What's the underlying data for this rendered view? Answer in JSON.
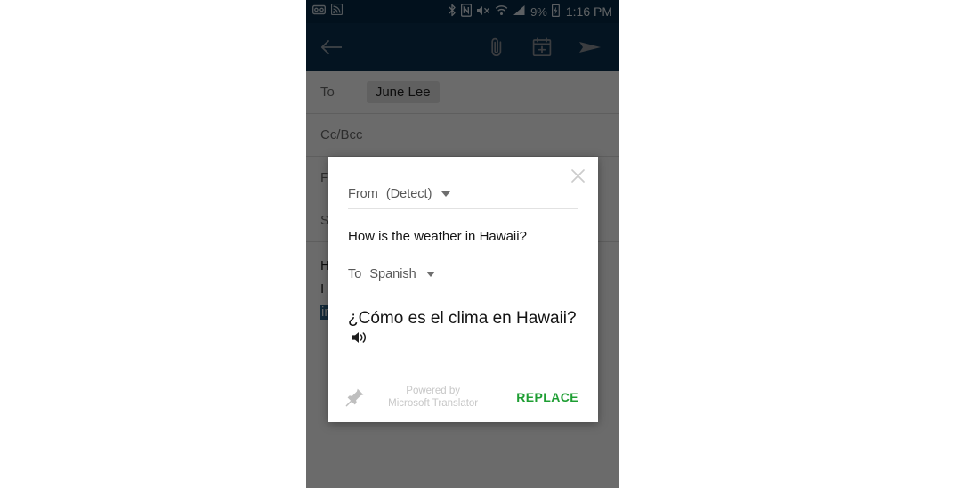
{
  "status_bar": {
    "left_icons": [
      "voicemail-icon",
      "rss-icon"
    ],
    "right_icons": [
      "bluetooth-icon",
      "nfc-icon",
      "volume-mute-icon",
      "wifi-icon",
      "cellular-signal-icon"
    ],
    "battery_percent": "9%",
    "battery_icon": "battery-charging-icon",
    "time": "1:16 PM"
  },
  "toolbar": {
    "back_icon": "back-arrow-icon",
    "attach_icon": "paperclip-icon",
    "calendar_icon": "calendar-add-icon",
    "send_icon": "send-icon"
  },
  "compose": {
    "to_label": "To",
    "to_chip": "June Lee",
    "cc_bcc_label": "Cc/Bcc",
    "from_label": "F",
    "subject_label": "S",
    "body_lines": [
      "H",
      "I",
      "in"
    ]
  },
  "dialog": {
    "close_icon": "close-icon",
    "from_label": "From",
    "from_value": "(Detect)",
    "from_caret": "chevron-down-icon",
    "source_text": "How is the weather in Hawaii?",
    "to_label": "To",
    "to_value": "Spanish",
    "to_caret": "chevron-down-icon",
    "target_text": "¿Cómo es el clima en Hawaii?",
    "speaker_icon": "speaker-icon",
    "pin_icon": "pin-icon",
    "powered_line1": "Powered by",
    "powered_line2": "Microsoft Translator",
    "replace_label": "REPLACE"
  },
  "colors": {
    "status_bar_bg": "#062a45",
    "toolbar_bg": "#0b3050",
    "accent_green": "#1e9e33",
    "selection_blue": "#2f6288",
    "scrim": "rgba(0,0,0,0.58)"
  }
}
